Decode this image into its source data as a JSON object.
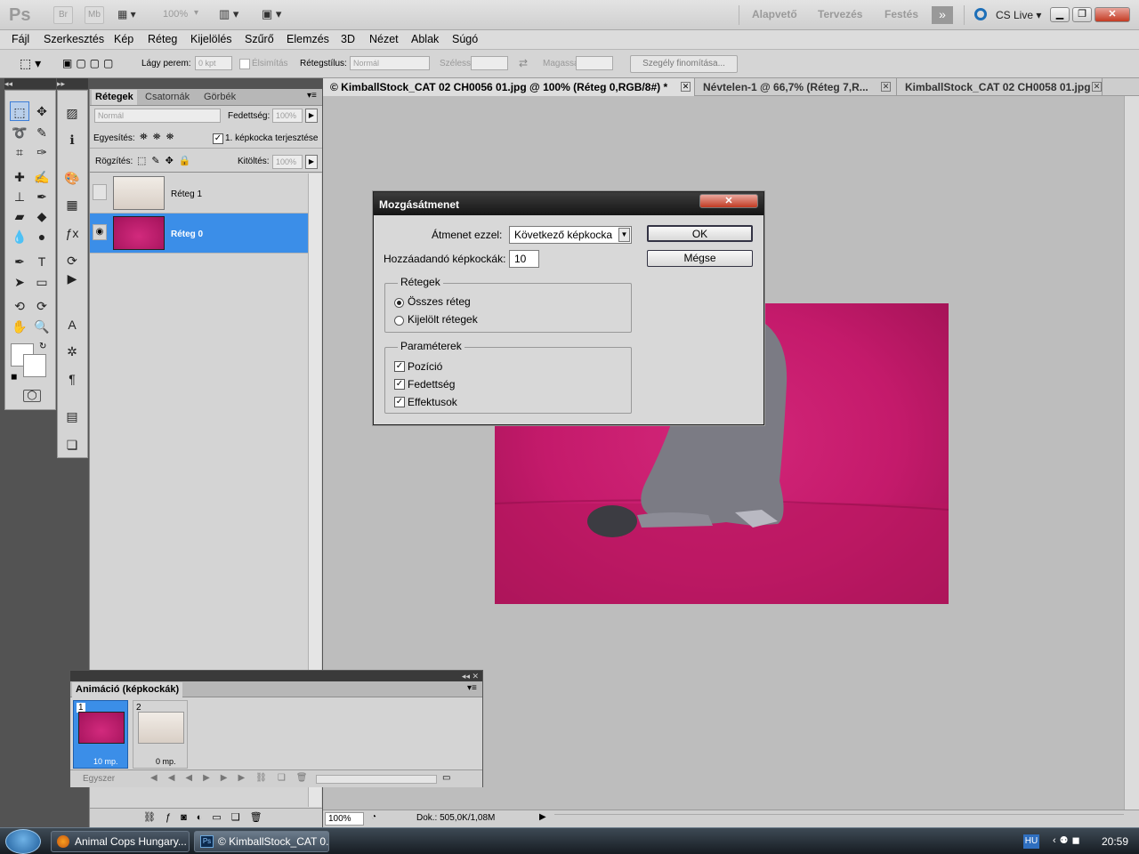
{
  "appbar": {
    "logo": "Ps",
    "bridge": "Br",
    "minibridge": "Mb",
    "zoom": "100%",
    "workspaces": [
      "Alapvető",
      "Tervezés",
      "Festés"
    ],
    "more": "»",
    "cslive": "CS Live"
  },
  "menu": [
    "Fájl",
    "Szerkesztés",
    "Kép",
    "Réteg",
    "Kijelölés",
    "Szűrő",
    "Elemzés",
    "3D",
    "Nézet",
    "Ablak",
    "Súgó"
  ],
  "options": {
    "feather_label": "Lágy perem:",
    "feather_value": "0 kpt",
    "antialias_label": "Élsimítás",
    "style_label": "Rétegstílus:",
    "style_value": "Normál",
    "width_label": "Szélesség:",
    "height_label": "Magasság:",
    "refine_button": "Szegély finomítása..."
  },
  "layers_panel": {
    "tabs": [
      "Rétegek",
      "Csatornák",
      "Görbék"
    ],
    "blend_mode": "Normál",
    "opacity_label": "Fedettség:",
    "opacity_value": "100%",
    "unify_label": "Egyesítés:",
    "propagate_label": "1. képkocka terjesztése",
    "lock_label": "Rögzítés:",
    "fill_label": "Kitöltés:",
    "fill_value": "100%",
    "layers": [
      {
        "name": "Réteg 1",
        "visible": false,
        "selected": false
      },
      {
        "name": "Réteg 0",
        "visible": true,
        "selected": true
      }
    ]
  },
  "doc_tabs": [
    {
      "title": "© KimballStock_CAT 02 CH0056 01.jpg @ 100% (Réteg 0,RGB/8#) *",
      "active": true
    },
    {
      "title": "Névtelen-1 @ 66,7% (Réteg 7,R...",
      "active": false
    },
    {
      "title": "KimballStock_CAT 02 CH0058 01.jpg",
      "active": false
    }
  ],
  "status": {
    "zoom": "100%",
    "doc": "Dok.: 505,0K/1,08M"
  },
  "dialog": {
    "title": "Mozgásátmenet",
    "tween_with_label": "Átmenet ezzel:",
    "tween_with_value": "Következő képkocka",
    "frames_label": "Hozzáadandó képkockák:",
    "frames_value": "10",
    "ok": "OK",
    "cancel": "Mégse",
    "layers_group": "Rétegek",
    "all_layers": "Összes réteg",
    "selected_layers": "Kijelölt rétegek",
    "layers_choice": "all",
    "params_group": "Paraméterek",
    "position": "Pozíció",
    "opacity": "Fedettség",
    "effects": "Effektusok",
    "position_checked": true,
    "opacity_checked": true,
    "effects_checked": true
  },
  "animation": {
    "title": "Animáció (képkockák)",
    "frames": [
      {
        "num": "1",
        "delay": "10 mp.",
        "selected": true
      },
      {
        "num": "2",
        "delay": "0 mp.",
        "selected": false
      }
    ],
    "loop": "Egyszer"
  },
  "taskbar": {
    "items": [
      "Animal Cops Hungary...",
      "© KimballStock_CAT 0..."
    ],
    "lang": "HU",
    "clock": "20:59"
  }
}
